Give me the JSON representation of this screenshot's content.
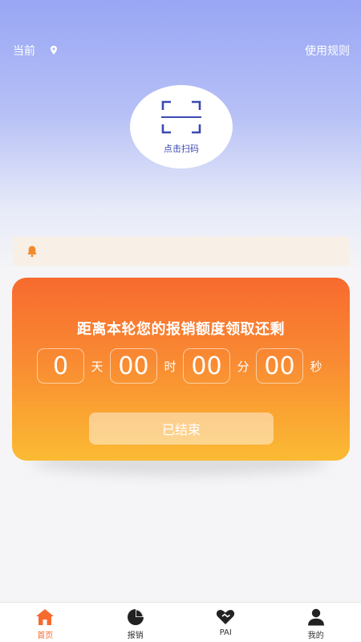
{
  "header": {
    "location_label": "当前",
    "rules_link": "使用规则"
  },
  "scan": {
    "label": "点击扫码"
  },
  "card": {
    "title": "距离本轮您的报销额度领取还剩",
    "days": "0",
    "days_unit": "天",
    "hours": "00",
    "hours_unit": "时",
    "minutes": "00",
    "minutes_unit": "分",
    "seconds": "00",
    "seconds_unit": "秒",
    "button_label": "已结束"
  },
  "tabs": [
    {
      "label": "首页",
      "icon": "home-icon",
      "active": true
    },
    {
      "label": "报销",
      "icon": "pie-chart-icon",
      "active": false
    },
    {
      "label": "PAI",
      "icon": "heart-handshake-icon",
      "active": false
    },
    {
      "label": "我的",
      "icon": "user-icon",
      "active": false
    }
  ],
  "colors": {
    "accent": "#f76a2f",
    "card_top": "#f76a2f",
    "card_bottom": "#fbbb33",
    "scan_blue": "#3c4ab0",
    "bell": "#f08a2c"
  }
}
